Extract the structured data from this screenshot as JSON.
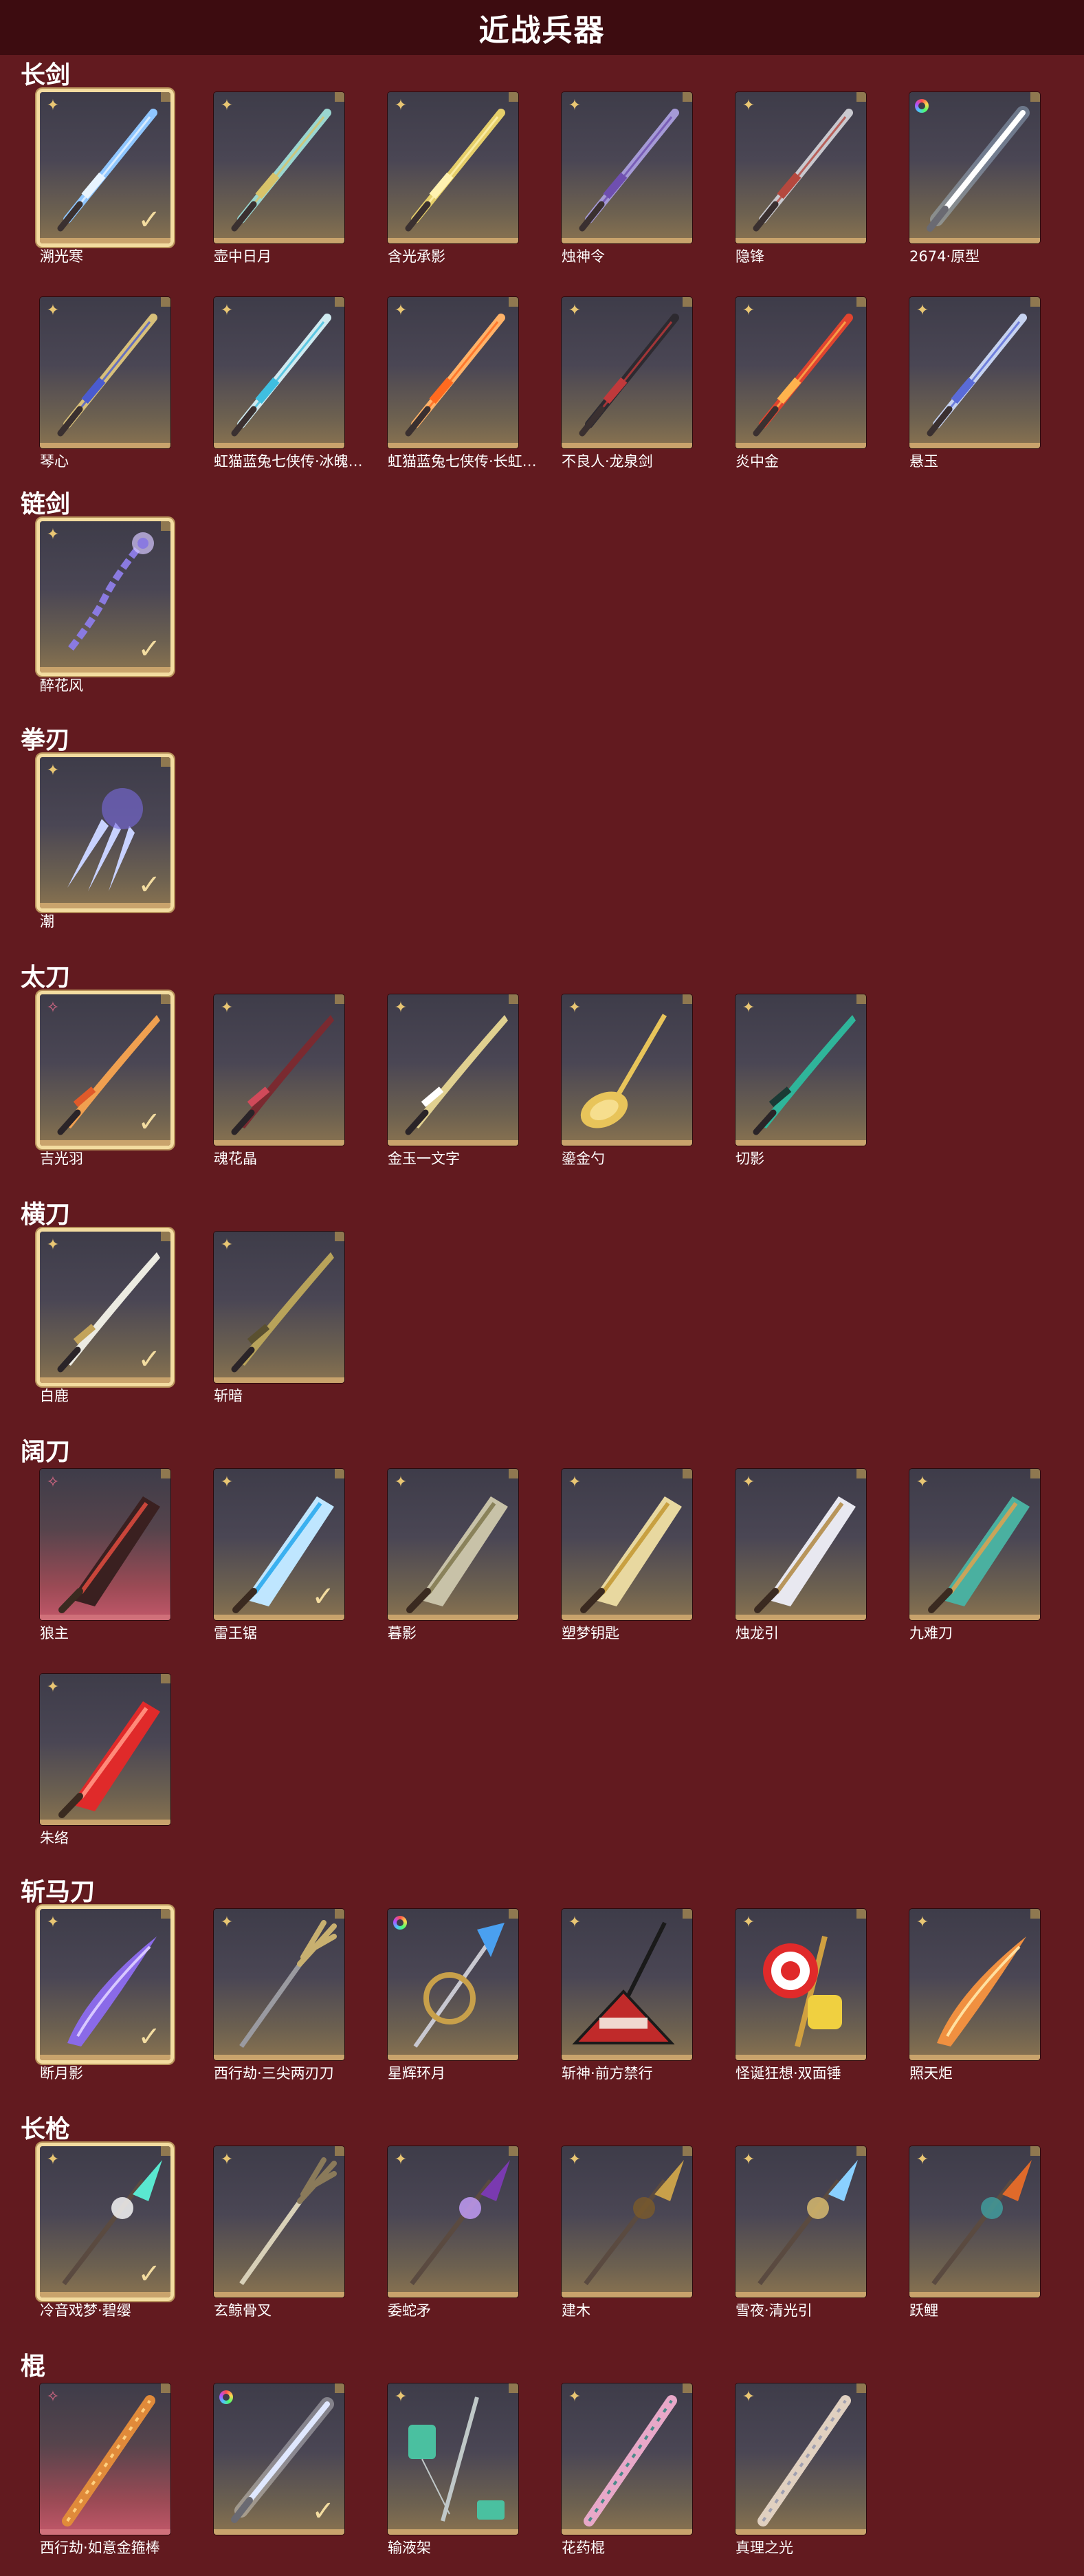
{
  "page": {
    "title": "近战兵器"
  },
  "colors": {
    "background": "#621a1f",
    "title_bar": "#3d0c10",
    "selected_border": "#f3dca0",
    "rank_gold": "#e9c673",
    "rank_pink": "#e06a88"
  },
  "sections": [
    {
      "label": "长剑",
      "items": [
        {
          "name": "溯光寒",
          "rank": "gold",
          "selected": true,
          "owned": true,
          "weapon": {
            "color": "#8fc6ff",
            "accent": "#e8f4ff",
            "style": "sword"
          }
        },
        {
          "name": "壶中日月",
          "rank": "gold",
          "weapon": {
            "color": "#9ad6d0",
            "accent": "#d8c36a",
            "style": "sword"
          }
        },
        {
          "name": "含光承影",
          "rank": "gold",
          "weapon": {
            "color": "#e6cf6a",
            "accent": "#fff2b0",
            "style": "sword"
          }
        },
        {
          "name": "烛神令",
          "rank": "gold",
          "weapon": {
            "color": "#a59ad6",
            "accent": "#6f4fb0",
            "style": "sword"
          }
        },
        {
          "name": "隐锋",
          "rank": "gold",
          "weapon": {
            "color": "#c9c9cf",
            "accent": "#b5483e",
            "style": "sword"
          }
        },
        {
          "name": "2674·原型",
          "rank": "ring",
          "weapon": {
            "color": "#bfe1ff",
            "accent": "#ffffff",
            "style": "glow"
          }
        },
        {
          "name": "琴心",
          "rank": "gold",
          "weapon": {
            "color": "#d8c07a",
            "accent": "#4a5bd0",
            "style": "sword"
          }
        },
        {
          "name": "虹猫蓝兔七侠传·冰魄…",
          "rank": "gold",
          "weapon": {
            "color": "#cfeaf0",
            "accent": "#3fbfe0",
            "style": "sword"
          }
        },
        {
          "name": "虹猫蓝兔七侠传·长虹…",
          "rank": "gold",
          "weapon": {
            "color": "#ffb268",
            "accent": "#ff6a1f",
            "style": "sword"
          }
        },
        {
          "name": "不良人·龙泉剑",
          "rank": "gold",
          "weapon": {
            "color": "#2d2a30",
            "accent": "#c0393b",
            "style": "sword"
          }
        },
        {
          "name": "炎中金",
          "rank": "gold",
          "weapon": {
            "color": "#e0442f",
            "accent": "#ffb34d",
            "style": "sword"
          }
        },
        {
          "name": "悬玉",
          "rank": "gold",
          "weapon": {
            "color": "#c6d2f0",
            "accent": "#5a6bd8",
            "style": "sword"
          }
        }
      ]
    },
    {
      "label": "链剑",
      "items": [
        {
          "name": "醉花风",
          "rank": "gold",
          "selected": true,
          "owned": true,
          "weapon": {
            "color": "#8a7ae0",
            "accent": "#d6c8ff",
            "style": "chain"
          }
        }
      ]
    },
    {
      "label": "拳刃",
      "items": [
        {
          "name": "潮",
          "rank": "gold",
          "selected": true,
          "owned": true,
          "weapon": {
            "color": "#c8d2ff",
            "accent": "#7a6ae0",
            "style": "claw"
          }
        }
      ]
    },
    {
      "label": "太刀",
      "items": [
        {
          "name": "吉光羽",
          "rank": "pink",
          "selected": true,
          "owned": true,
          "weapon": {
            "color": "#f0a050",
            "accent": "#e05a2a",
            "style": "katana"
          }
        },
        {
          "name": "魂花晶",
          "rank": "gold",
          "weapon": {
            "color": "#7a2a30",
            "accent": "#d04a5a",
            "style": "katana"
          }
        },
        {
          "name": "金玉一文字",
          "rank": "gold",
          "weapon": {
            "color": "#e0d090",
            "accent": "#ffffff",
            "style": "katana"
          }
        },
        {
          "name": "鎏金勺",
          "rank": "gold",
          "weapon": {
            "color": "#e8c45a",
            "accent": "#fff0b0",
            "style": "spoon"
          }
        },
        {
          "name": "切影",
          "rank": "gold",
          "weapon": {
            "color": "#2fb59a",
            "accent": "#1a3a35",
            "style": "katana"
          }
        }
      ]
    },
    {
      "label": "横刀",
      "items": [
        {
          "name": "白鹿",
          "rank": "gold",
          "selected": true,
          "owned": true,
          "weapon": {
            "color": "#ecebe2",
            "accent": "#c2a35a",
            "style": "katana"
          }
        },
        {
          "name": "斩暗",
          "rank": "gold",
          "weapon": {
            "color": "#b8a35a",
            "accent": "#5a5030",
            "style": "katana"
          }
        }
      ]
    },
    {
      "label": "阔刀",
      "items": [
        {
          "name": "狼主",
          "rank": "pink",
          "red": true,
          "weapon": {
            "color": "#3a2020",
            "accent": "#c8453a",
            "style": "broad"
          }
        },
        {
          "name": "雷王锯",
          "rank": "gold",
          "owned": true,
          "weapon": {
            "color": "#bfe6ff",
            "accent": "#3ab0f0",
            "style": "broad"
          }
        },
        {
          "name": "暮影",
          "rank": "gold",
          "weapon": {
            "color": "#c8c2a8",
            "accent": "#8a825a",
            "style": "broad"
          }
        },
        {
          "name": "塑梦钥匙",
          "rank": "gold",
          "weapon": {
            "color": "#e8d8a0",
            "accent": "#c8a040",
            "style": "broad"
          }
        },
        {
          "name": "烛龙引",
          "rank": "gold",
          "weapon": {
            "color": "#e8e8f0",
            "accent": "#b8955a",
            "style": "broad"
          }
        },
        {
          "name": "九难刀",
          "rank": "gold",
          "weapon": {
            "color": "#4ab0a0",
            "accent": "#c8a45a",
            "style": "broad"
          }
        },
        {
          "name": "朱络",
          "rank": "gold",
          "weapon": {
            "color": "#e02a2a",
            "accent": "#ff8a7a",
            "style": "broad"
          }
        }
      ]
    },
    {
      "label": "斩马刀",
      "items": [
        {
          "name": "断月影",
          "rank": "gold",
          "selected": true,
          "owned": true,
          "weapon": {
            "color": "#8a6ae8",
            "accent": "#d8c8ff",
            "style": "curved"
          }
        },
        {
          "name": "西行劫·三尖两刃刀",
          "rank": "gold",
          "weapon": {
            "color": "#9a9aa0",
            "accent": "#c8b070",
            "style": "trident"
          }
        },
        {
          "name": "星辉环月",
          "rank": "ring",
          "weapon": {
            "color": "#4aa0f0",
            "accent": "#c8a04a",
            "style": "ring"
          }
        },
        {
          "name": "斩神·前方禁行",
          "rank": "gold",
          "weapon": {
            "color": "#c02a2a",
            "accent": "#1a1a1a",
            "style": "sign"
          }
        },
        {
          "name": "怪诞狂想·双面锤",
          "rank": "gold",
          "weapon": {
            "color": "#f0d040",
            "accent": "#e02a2a",
            "style": "hammer"
          }
        },
        {
          "name": "照天炬",
          "rank": "gold",
          "weapon": {
            "color": "#f09040",
            "accent": "#ffe0a0",
            "style": "curved"
          }
        }
      ]
    },
    {
      "label": "长枪",
      "items": [
        {
          "name": "冷音戏梦·碧缨",
          "rank": "gold",
          "selected": true,
          "owned": true,
          "weapon": {
            "color": "#5ae8d0",
            "accent": "#ffffff",
            "style": "spear"
          }
        },
        {
          "name": "玄鲸骨叉",
          "rank": "gold",
          "weapon": {
            "color": "#d8d0b8",
            "accent": "#8a7a5a",
            "style": "trident"
          }
        },
        {
          "name": "委蛇矛",
          "rank": "gold",
          "weapon": {
            "color": "#7a3ab0",
            "accent": "#c8a0ff",
            "style": "spear"
          }
        },
        {
          "name": "建木",
          "rank": "gold",
          "weapon": {
            "color": "#c8a04a",
            "accent": "#7a5a2a",
            "style": "spear"
          }
        },
        {
          "name": "雪夜·清光引",
          "rank": "gold",
          "weapon": {
            "color": "#8ad0ff",
            "accent": "#e0c070",
            "style": "spear"
          }
        },
        {
          "name": "跃鲤",
          "rank": "gold",
          "weapon": {
            "color": "#e06a2a",
            "accent": "#40a0a0",
            "style": "spear"
          }
        }
      ]
    },
    {
      "label": "棍",
      "items": [
        {
          "name": "西行劫·如意金箍棒",
          "rank": "pink",
          "red": true,
          "weapon": {
            "color": "#e08a3a",
            "accent": "#ffd080",
            "style": "staff"
          }
        },
        {
          "name": "",
          "rank": "ring",
          "owned": true,
          "weapon": {
            "color": "#ffffff",
            "accent": "#e0e8ff",
            "style": "glow"
          }
        },
        {
          "name": "输液架",
          "rank": "gold",
          "weapon": {
            "color": "#c0c8c8",
            "accent": "#4ac0a0",
            "style": "iv"
          }
        },
        {
          "name": "花药棍",
          "rank": "gold",
          "weapon": {
            "color": "#e8a8c8",
            "accent": "#4a8a8a",
            "style": "staff"
          }
        },
        {
          "name": "真理之光",
          "rank": "gold",
          "weapon": {
            "color": "#e0d0c0",
            "accent": "#a0a0b0",
            "style": "staff"
          }
        }
      ]
    }
  ]
}
